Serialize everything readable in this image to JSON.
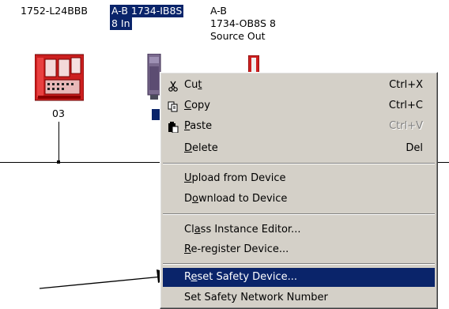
{
  "devices": {
    "dev1_name": "1752-L24BBB",
    "dev2_name_line1": "A-B 1734-IB8S",
    "dev2_name_line2": "8 In",
    "dev3_name_line1": "A-B",
    "dev3_name_line2": "1734-OB8S 8",
    "dev3_name_line3": "Source Out",
    "dev1_address": "03"
  },
  "menu": {
    "cut": {
      "pre": "Cu",
      "acc": "t",
      "post": "",
      "key": "Ctrl+X"
    },
    "copy": {
      "pre": "",
      "acc": "C",
      "post": "opy",
      "key": "Ctrl+C"
    },
    "paste": {
      "pre": "",
      "acc": "P",
      "post": "aste",
      "key": "Ctrl+V"
    },
    "delete": {
      "pre": "",
      "acc": "D",
      "post": "elete",
      "key": "Del"
    },
    "upload": {
      "pre": "",
      "acc": "U",
      "post": "pload from Device"
    },
    "download": {
      "pre": "D",
      "acc": "o",
      "post": "wnload to Device"
    },
    "class_editor": {
      "pre": "Cl",
      "acc": "a",
      "post": "ss Instance Editor..."
    },
    "reregister": {
      "pre": "",
      "acc": "R",
      "post": "e-register Device..."
    },
    "reset_safety": {
      "pre": "R",
      "acc": "e",
      "post": "set Safety Device..."
    },
    "set_snn": {
      "pre": "Set Safety Network Number",
      "acc": "",
      "post": ""
    }
  },
  "colors": {
    "selection": "#0a246a",
    "menu_bg": "#d4d0c8",
    "device_red": "#cc1f1f"
  },
  "icons": [
    "scissors-icon",
    "copy-icon",
    "paste-icon"
  ]
}
